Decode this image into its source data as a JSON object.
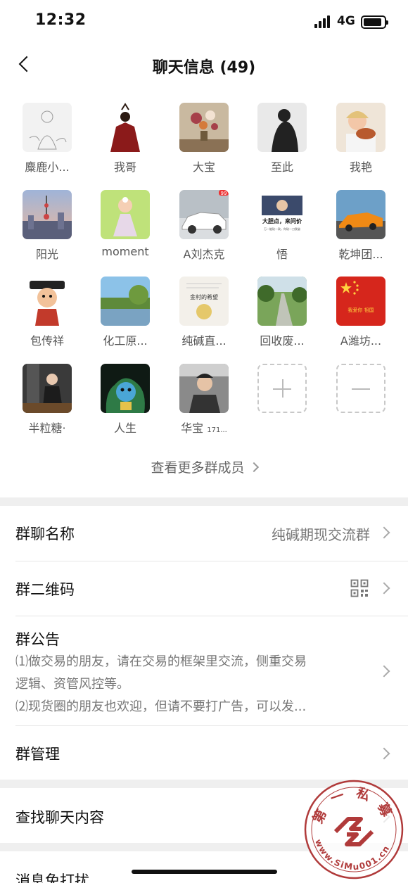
{
  "status": {
    "time": "12:32",
    "network": "4G"
  },
  "nav": {
    "title": "聊天信息 (49)"
  },
  "members": [
    {
      "name": "麋鹿小...",
      "avatar": "sketch-girl",
      "colors": [
        "#f2f2f2",
        "#9a9a9a"
      ]
    },
    {
      "name": "我哥",
      "avatar": "warrior",
      "colors": [
        "#ffffff",
        "#8b1a1a"
      ]
    },
    {
      "name": "大宝",
      "avatar": "flowers",
      "colors": [
        "#c9b9a0",
        "#a6404a"
      ]
    },
    {
      "name": "至此",
      "avatar": "bw-woman",
      "colors": [
        "#e9e9e9",
        "#222222"
      ]
    },
    {
      "name": "我艳",
      "avatar": "baby-eating",
      "colors": [
        "#d8a488",
        "#b85a2e"
      ]
    },
    {
      "name": "阳光",
      "avatar": "city-tower",
      "colors": [
        "#9fb4d8",
        "#5a5f7a"
      ]
    },
    {
      "name": "moment",
      "avatar": "baby-dress",
      "colors": [
        "#bfe27a",
        "#e7d8e8"
      ]
    },
    {
      "name": "A刘杰克",
      "avatar": "white-car",
      "colors": [
        "#dadde0",
        "#ffffff"
      ],
      "badge": "99"
    },
    {
      "name": "悟",
      "avatar": "poster",
      "colors": [
        "#ffffff",
        "#444444"
      ],
      "poster_title": "大胆点，来问价",
      "poster_sub": "万一能砍一砍，你砍一刀我省"
    },
    {
      "name": "乾坤团...",
      "avatar": "orange-car",
      "colors": [
        "#6da0c8",
        "#f08a15"
      ]
    },
    {
      "name": "包传祥",
      "avatar": "cartoon-man",
      "colors": [
        "#ffffff",
        "#c23a2b"
      ]
    },
    {
      "name": "化工原...",
      "avatar": "lake",
      "colors": [
        "#8cc2e8",
        "#5e8a3a"
      ]
    },
    {
      "name": "纯碱直...",
      "avatar": "moon-card",
      "colors": [
        "#f3f0ea",
        "#e5c86a"
      ],
      "card_text": "金村的希望"
    },
    {
      "name": "回收废...",
      "avatar": "road",
      "colors": [
        "#7aa55a",
        "#c0c4b8"
      ]
    },
    {
      "name": "A潍坊...",
      "avatar": "flag",
      "colors": [
        "#d6261c",
        "#ffd23f"
      ],
      "flag_text": "我爱你 祖国"
    },
    {
      "name": "半粒糖·",
      "avatar": "woman-room",
      "colors": [
        "#3a3a3a",
        "#1c1c1c"
      ]
    },
    {
      "name": "人生",
      "avatar": "cartoon-dog",
      "colors": [
        "#0f1a14",
        "#4aa6d6"
      ]
    },
    {
      "name": "华宝",
      "name_suffix": "171...",
      "avatar": "man-car",
      "colors": [
        "#8a8a8a",
        "#333333"
      ]
    }
  ],
  "more_members": "查看更多群成员",
  "rows": {
    "group_name": {
      "label": "群聊名称",
      "value": "纯碱期现交流群"
    },
    "qr_code": {
      "label": "群二维码"
    },
    "announcement": {
      "label": "群公告",
      "lines": [
        "⑴做交易的朋友，请在交易的框架里交流，侧重交易",
        "逻辑、资管风控等。",
        "⑵现货圈的朋友也欢迎，但请不要打广告，可以发..."
      ]
    },
    "manage": {
      "label": "群管理"
    },
    "search": {
      "label": "查找聊天内容"
    },
    "mute": {
      "label": "消息免打扰"
    }
  },
  "watermark": {
    "top_text": "第一私募",
    "bottom_text": "www.SiMu001.cn",
    "color": "#b03a3a"
  }
}
